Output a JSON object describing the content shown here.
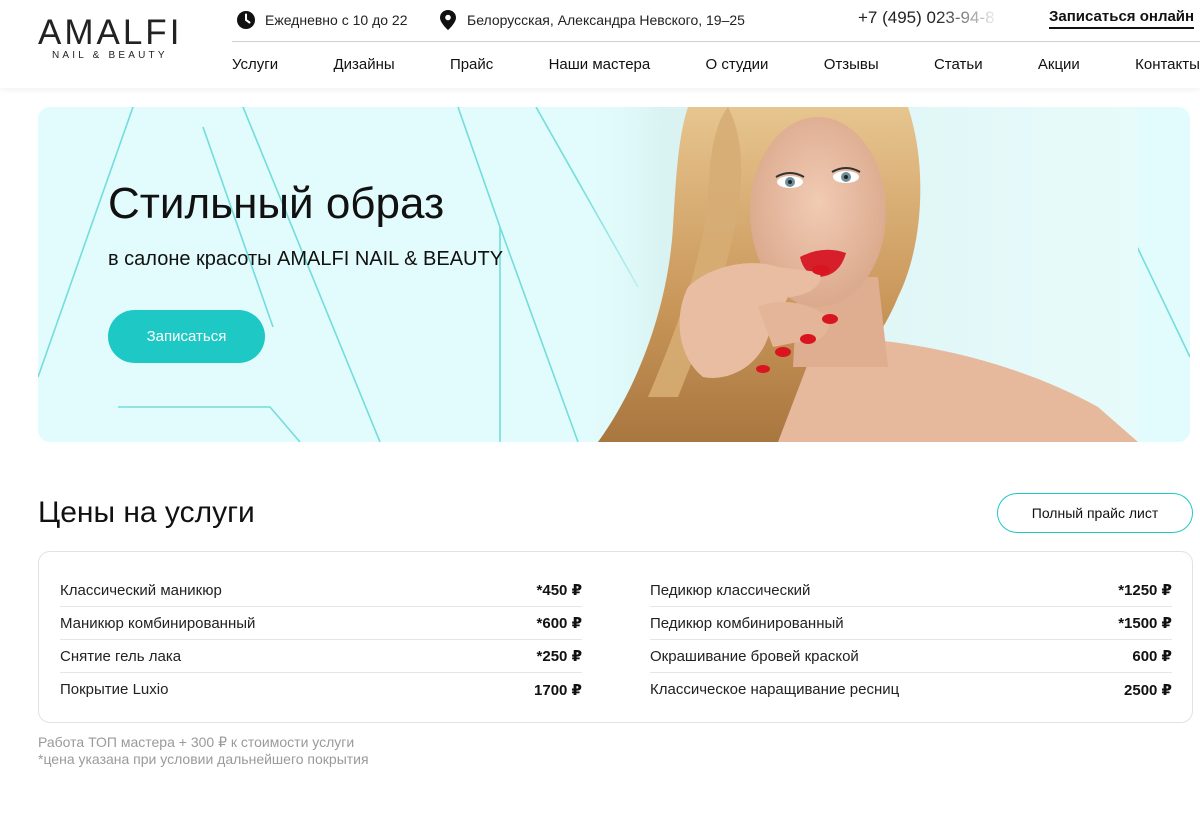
{
  "brand": {
    "name": "AMALFI",
    "tagline": "NAIL & BEAUTY"
  },
  "topbar": {
    "hours": "Ежедневно с 10 до 22",
    "address": "Белорусская, Александра Невского, 19–25",
    "phone": "+7 (495) 023-94-8",
    "signup": "Записаться онлайн"
  },
  "nav": [
    "Услуги",
    "Дизайны",
    "Прайс",
    "Наши мастера",
    "О студии",
    "Отзывы",
    "Статьи",
    "Акции",
    "Контакты"
  ],
  "hero": {
    "title": "Стильный образ",
    "subtitle": "в салоне красоты AMALFI NAIL & BEAUTY",
    "button": "Записаться"
  },
  "prices": {
    "title": "Цены на услуги",
    "full_list_button": "Полный прайс лист",
    "left": [
      {
        "name": "Классический маникюр",
        "price": "*450 ₽"
      },
      {
        "name": "Маникюр комбинированный",
        "price": "*600 ₽"
      },
      {
        "name": "Снятие гель лака",
        "price": "*250 ₽"
      },
      {
        "name": "Покрытие Luxio",
        "price": "1700 ₽"
      }
    ],
    "right": [
      {
        "name": "Педикюр классический",
        "price": "*1250 ₽"
      },
      {
        "name": "Педикюр комбинированный",
        "price": "*1500 ₽"
      },
      {
        "name": "Окрашивание бровей краской",
        "price": "600 ₽"
      },
      {
        "name": "Классическое наращивание ресниц",
        "price": "2500 ₽"
      }
    ],
    "note1": "Работа ТОП мастера + 300 ₽ к стоимости услуги",
    "note2": "*цена указана при условии дальнейшего покрытия"
  },
  "colors": {
    "accent": "#1ec9c5",
    "hero_bg": "#e2fbfc",
    "text": "#111111",
    "muted": "#9a9a9a"
  },
  "icons": {
    "hours": "clock-icon",
    "address": "location-pin-icon"
  }
}
